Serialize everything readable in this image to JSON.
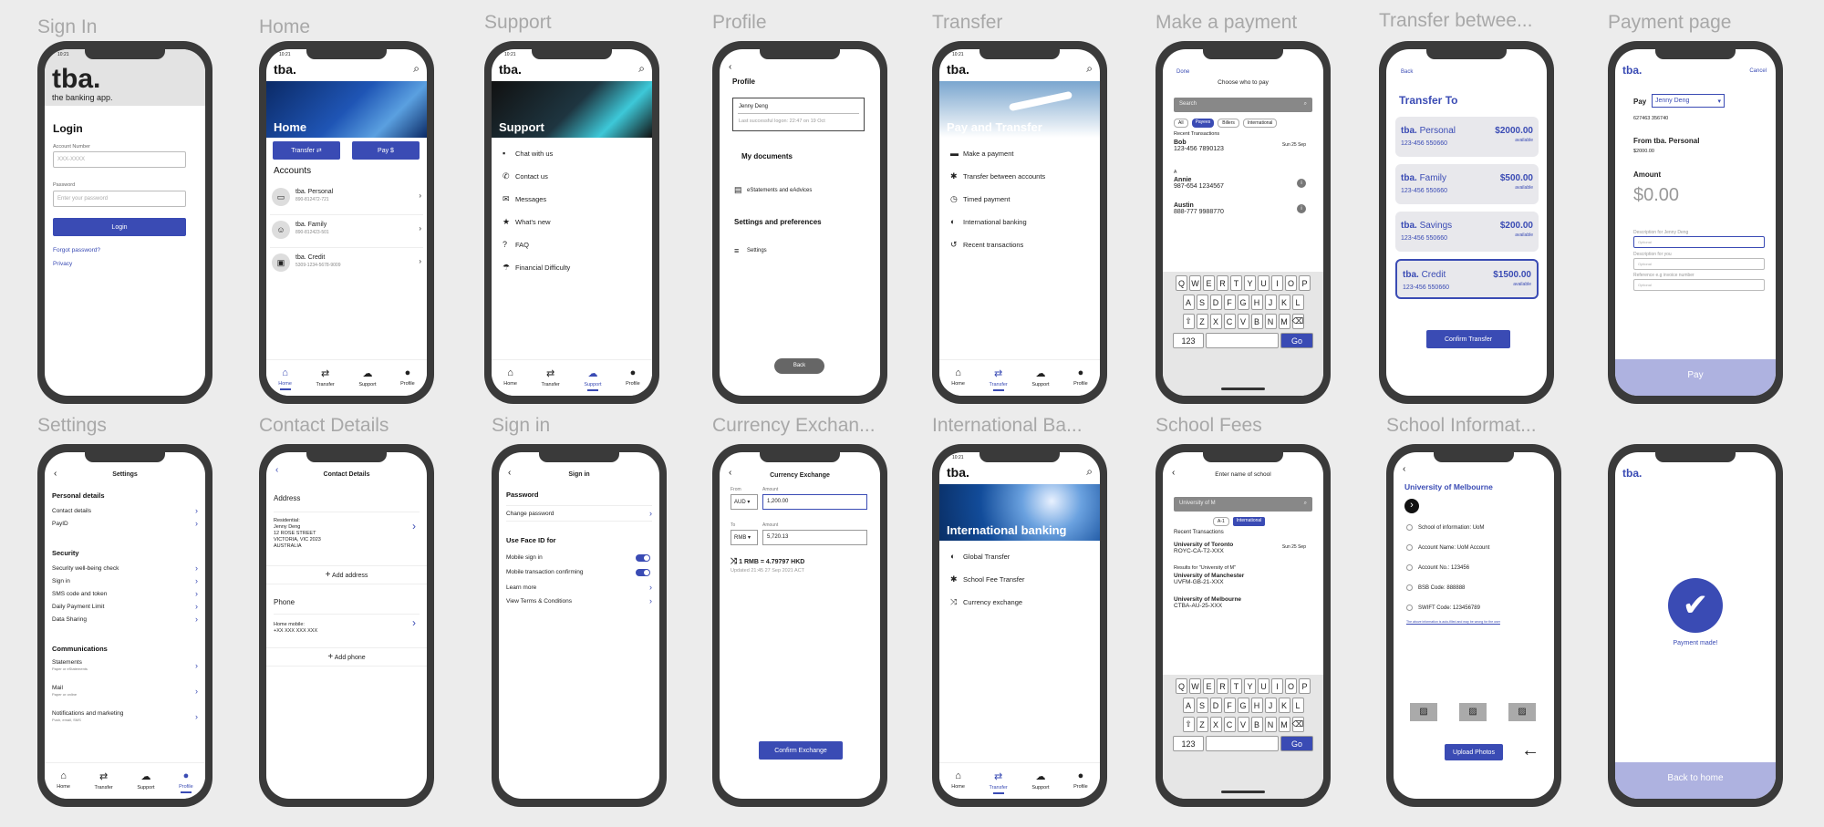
{
  "labels": [
    "Sign In",
    "Home",
    "Support",
    "Profile",
    "Transfer",
    "Make a payment",
    "Transfer betwee...",
    "Payment page",
    "Settings",
    "Contact Details",
    "Sign in",
    "Currency Exchan...",
    "International Ba...",
    "School Fees",
    "School Informat..."
  ],
  "brand": {
    "logo": "tba.",
    "tagline": "the banking app.",
    "accent": "#3a4bb4"
  },
  "status": {
    "time": "10:21"
  },
  "tabs": {
    "home": "Home",
    "transfer": "Transfer",
    "support": "Support",
    "profile": "Profile"
  },
  "signin": {
    "title": "Login",
    "acct_label": "Account Number",
    "acct_ph": "XXX-XXXX",
    "pw_label": "Password",
    "pw_ph": "Enter your password",
    "login": "Login",
    "forgot": "Forgot password?",
    "privacy": "Privacy"
  },
  "home": {
    "hero": "Home",
    "transfer": "Transfer ⇄",
    "pay": "Pay $",
    "accounts": "Accounts",
    "items": [
      {
        "name": "tba. Personal",
        "no": "890-812472-721"
      },
      {
        "name": "tba. Family",
        "no": "890-812423-501"
      },
      {
        "name": "tba. Credit",
        "no": "5309-1234-5678-9009"
      }
    ]
  },
  "support": {
    "hero": "Support",
    "items": [
      "Chat with us",
      "Contact us",
      "Messages",
      "What's new",
      "FAQ",
      "Financial Difficulty"
    ]
  },
  "profile": {
    "title": "Profile",
    "name": "Jenny Deng",
    "last": "Last successful logon: 22:47 on 19 Oct",
    "docs": "My documents",
    "estatements": "eStatements and eAdvices",
    "settings_h": "Settings and preferences",
    "settings": "Settings",
    "back": "Back"
  },
  "transfer": {
    "hero": "Pay and Transfer",
    "items": [
      "Make a payment",
      "Transfer between accounts",
      "Timed payment",
      "International banking",
      "Recent transactions"
    ]
  },
  "makepay": {
    "done": "Done",
    "title": "Choose who to pay",
    "search": "Search",
    "filters": [
      "All",
      "Payees",
      "Billers",
      "International"
    ],
    "recent": "Recent Transactions",
    "bob": "Bob",
    "bob_no": "123-456 7890123",
    "bob_date": "Sun 25 Sep",
    "a": "A",
    "annie": "Annie",
    "annie_no": "987-654 1234567",
    "austin": "Austin",
    "austin_no": "888-777 9988770",
    "n123": "123",
    "go": "Go"
  },
  "transfer_between": {
    "back": "Back",
    "title": "Transfer To",
    "accounts": [
      {
        "name": "Personal",
        "no": "123-456 550660",
        "amt": "$2000.00"
      },
      {
        "name": "Family",
        "no": "123-456 550660",
        "amt": "$500.00"
      },
      {
        "name": "Savings",
        "no": "123-456 550660",
        "amt": "$200.00"
      },
      {
        "name": "Credit",
        "no": "123-456 550660",
        "amt": "$1500.00"
      }
    ],
    "available": "available",
    "prefix": "tba.",
    "confirm": "Confirm Transfer"
  },
  "paypage": {
    "cancel": "Cancel",
    "pay": "Pay",
    "payee": "Jenny Deng",
    "acct": "627463 356740",
    "from": "From tba. Personal",
    "from_bal": "$2000.00",
    "amount_l": "Amount",
    "amount": "$0.00",
    "desc1": "Description for Jenny Deng",
    "desc2": "Description for you",
    "ref": "Reference e.g invoice number",
    "opt": "Optional",
    "btn": "Pay"
  },
  "settings": {
    "title": "Settings",
    "personal": "Personal details",
    "contact": "Contact details",
    "payid": "PayID",
    "security": "Security",
    "sec": [
      "Security well-being check",
      "Sign in",
      "SMS code and token",
      "Daily Payment Limit",
      "Data Sharing"
    ],
    "comms": "Communications",
    "statements": "Statements",
    "statements_s": "Paper or eStatements",
    "mail": "Mail",
    "mail_s": "Paper or online",
    "notif": "Notifications and marketing",
    "notif_s": "Push, email, SMS"
  },
  "contact": {
    "title": "Contact Details",
    "address": "Address",
    "res": "Residential:",
    "l1": "Jenny Deng",
    "l2": "12 ROSE STREET",
    "l3": "VICTORIA, VIC 2023",
    "l4": "AUSTRALIA",
    "add_addr": "Add address",
    "phone": "Phone",
    "mobile": "Home mobile:",
    "mobile_no": "+XX XXX XXX XXX",
    "add_phone": "Add phone"
  },
  "signin2": {
    "title": "Sign in",
    "password": "Password",
    "change": "Change password",
    "faceid": "Use Face ID for",
    "mobile": "Mobile sign in",
    "confirm": "Mobile transaction confirming",
    "learn": "Learn more",
    "terms": "View Terms & Conditions"
  },
  "currency": {
    "title": "Currency Exchange",
    "from": "From",
    "amount": "Amount",
    "aud": "AUD",
    "v1": "1,200.00",
    "to": "To",
    "rmb": "RMB",
    "v2": "5,720.13",
    "rate": "1 RMB = 4.79797 HKD",
    "updated": "Updated 21:45 27 Sep 2021 ACT",
    "btn": "Confirm Exchange"
  },
  "intl": {
    "hero": "International banking",
    "items": [
      "Global Transfer",
      "School Fee Transfer",
      "Currency exchange"
    ]
  },
  "school": {
    "title": "Enter name of school",
    "search": "University of M",
    "c1": "A-1",
    "c2": "International",
    "recent": "Recent Transactions",
    "t1": "University of Toronto",
    "t1n": "ROYC-CA-T2-XXX",
    "t1d": "Sun 25 Sep",
    "results": "Results for \"University of M\"",
    "r1": "University of Manchester",
    "r1n": "UVFM-GB-21-XXX",
    "r2": "University of Melbourne",
    "r2n": "CTBA-AU-25-XXX"
  },
  "schoolinfo": {
    "title": "University of Melbourne",
    "items": [
      "School of information: UoM",
      "Account Name: UoM Account",
      "Account No.: 123456",
      "BSB Code: 888888",
      "SWIFT Code: 123456789"
    ],
    "note": "The above information is auto-filled and may be wrong for the user",
    "upload": "Upload Photos"
  },
  "done": {
    "made": "Payment made!",
    "back": "Back to home"
  }
}
